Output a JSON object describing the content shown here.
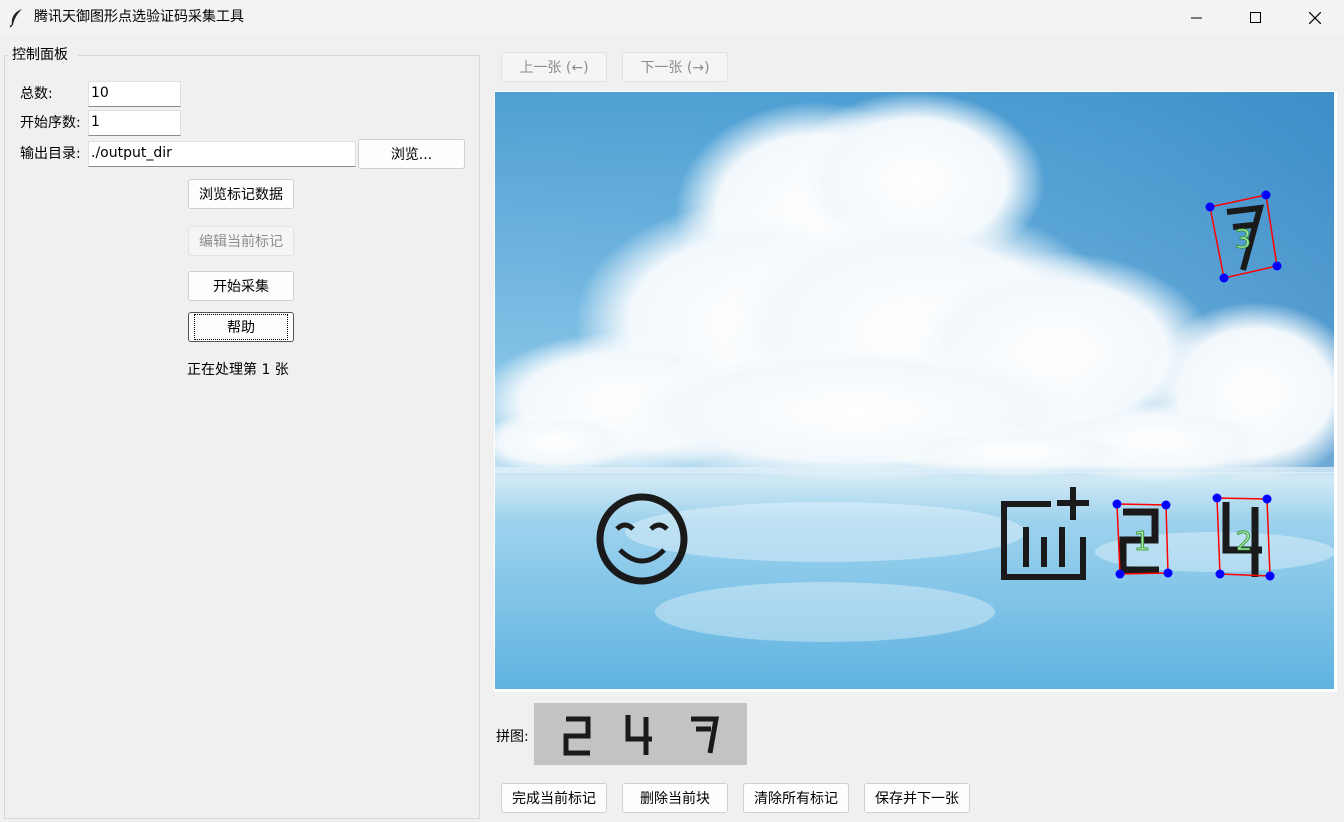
{
  "window": {
    "title": "腾讯天御图形点选验证码采集工具",
    "icon": "feather-icon",
    "controls": [
      "minimize-icon",
      "maximize-icon",
      "close-icon"
    ]
  },
  "panel": {
    "legend": "控制面板",
    "total_label": "总数:",
    "total_value": "10",
    "start_label": "开始序数:",
    "start_value": "1",
    "output_label": "输出目录:",
    "output_value": "./output_dir",
    "browse_button": "浏览...",
    "browse_marks_button": "浏览标记数据",
    "edit_marks_button": "编辑当前标记",
    "start_collect_button": "开始采集",
    "help_button": "帮助",
    "status_text": "正在处理第 1 张"
  },
  "nav": {
    "prev_button": "上一张 (←)",
    "next_button": "下一张 (→)"
  },
  "canvas": {
    "marks": [
      {
        "order": "3",
        "glyph": "7"
      },
      {
        "order": "1",
        "glyph": "2"
      },
      {
        "order": "2",
        "glyph": "4"
      }
    ],
    "unmarked_icons": [
      "smiley-icon",
      "chart-plus-icon"
    ],
    "mark_color": "#ff0000",
    "corner_color": "#0000ff",
    "order_label_color": "#00aa00"
  },
  "puzzle": {
    "label": "拼图:",
    "glyphs": [
      "2",
      "4",
      "7"
    ]
  },
  "actions": {
    "finish_button": "完成当前标记",
    "delete_button": "删除当前块",
    "clear_button": "清除所有标记",
    "save_next_button": "保存并下一张"
  }
}
